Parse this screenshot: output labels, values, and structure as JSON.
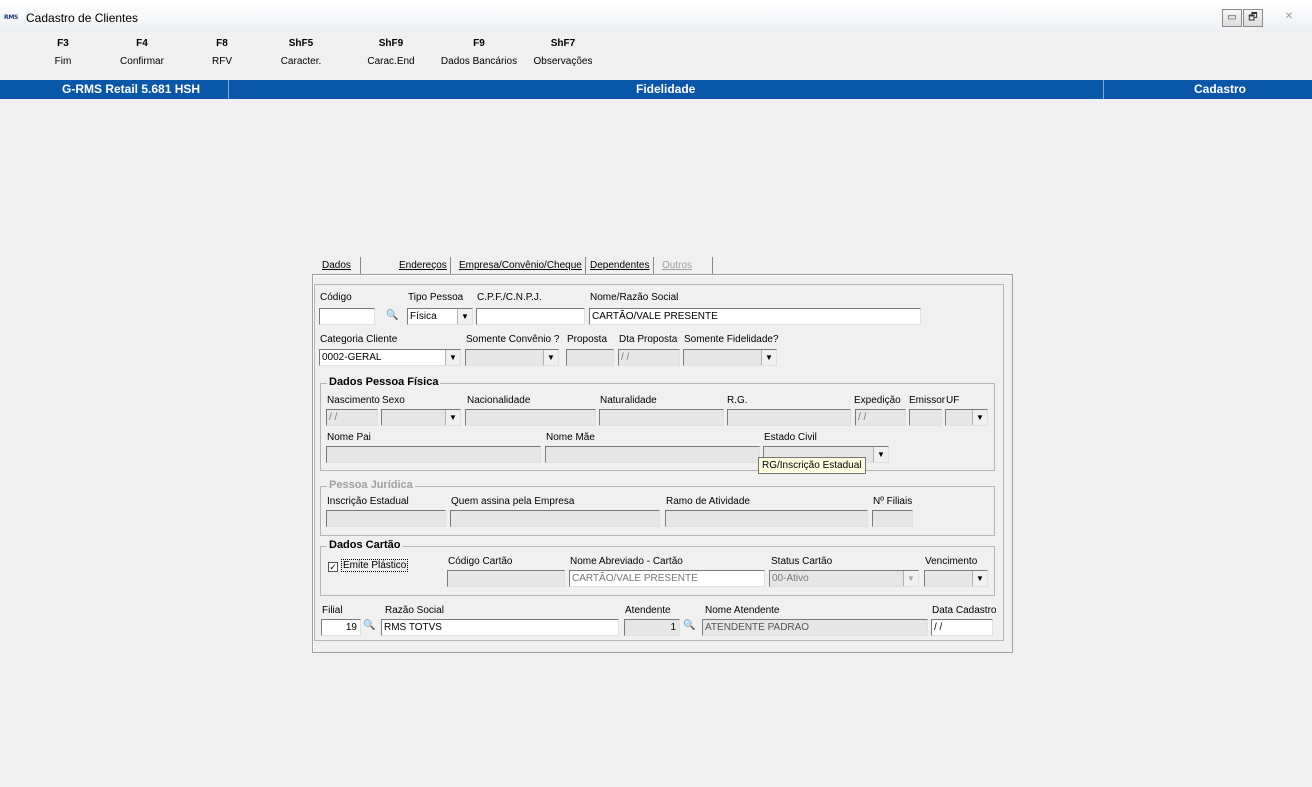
{
  "window": {
    "app_icon": "RMS",
    "title": "Cadastro de Clientes",
    "controls": [
      "▭",
      "🗗",
      "✕"
    ]
  },
  "function_keys": [
    {
      "key": "F3",
      "label": "Fim"
    },
    {
      "key": "F4",
      "label": "Confirmar"
    },
    {
      "key": "F8",
      "label": "RFV"
    },
    {
      "key": "ShF5",
      "label": "Caracter."
    },
    {
      "key": "ShF9",
      "label": "Carac.End"
    },
    {
      "key": "F9",
      "label": "Dados Bancários"
    },
    {
      "key": "ShF7",
      "label": "Observações"
    }
  ],
  "status_bar": {
    "left": "G-RMS Retail 5.681 HSH",
    "center": "Fidelidade",
    "right": "Cadastro"
  },
  "tabs": [
    {
      "label": "Dados Básicos",
      "state": "active"
    },
    {
      "label": "Endereços",
      "state": "normal"
    },
    {
      "label": "Empresa/Convênio/Cheque",
      "state": "normal"
    },
    {
      "label": "Dependentes",
      "state": "normal"
    },
    {
      "label": "Outros Convênios",
      "state": "disabled"
    }
  ],
  "basic": {
    "codigo_label": "Código",
    "codigo_value": "",
    "tipo_pessoa_label": "Tipo Pessoa",
    "tipo_pessoa_value": "Física",
    "cpf_label": "C.P.F./C.N.P.J.",
    "cpf_value": "",
    "nome_label": "Nome/Razão Social",
    "nome_value": "CARTÃO/VALE PRESENTE",
    "categoria_label": "Categoria Cliente",
    "categoria_value": "0002-GERAL",
    "somente_convenio_label": "Somente Convênio ?",
    "proposta_label": "Proposta",
    "dta_proposta_label": "Dta Proposta",
    "dta_proposta_value": "/ /",
    "somente_fidelidade_label": "Somente Fidelidade?"
  },
  "pessoa_fisica": {
    "title": "Dados Pessoa Física",
    "nascimento_label": "Nascimento",
    "nascimento_value": "/ /",
    "sexo_label": "Sexo",
    "nacionalidade_label": "Nacionalidade",
    "naturalidade_label": "Naturalidade",
    "rg_label": "R.G.",
    "expedicao_label": "Expedição",
    "expedicao_value": "/ /",
    "emissor_label": "Emissor",
    "uf_label": "UF",
    "nome_pai_label": "Nome Pai",
    "nome_mae_label": "Nome Mãe",
    "estado_civil_label": "Estado Civil",
    "tooltip": "RG/Inscrição Estadual"
  },
  "pessoa_juridica": {
    "title": "Pessoa Jurídica",
    "inscricao_label": "Inscrição Estadual",
    "quem_assina_label": "Quem assina pela Empresa",
    "ramo_label": "Ramo de Atividade",
    "filiais_label": "Nº Filiais"
  },
  "cartao": {
    "title": "Dados Cartão",
    "emite_label": "Emite Plástico",
    "emite_checked": "✓",
    "codigo_label": "Código Cartão",
    "nome_abrev_label": "Nome Abreviado - Cartão",
    "nome_abrev_value": "CARTÃO/VALE PRESENTE",
    "status_label": "Status Cartão",
    "status_value": "00-Ativo",
    "vencimento_label": "Vencimento"
  },
  "footer": {
    "filial_label": "Filial",
    "filial_value": "19",
    "razao_label": "Razão Social",
    "razao_value": "RMS TOTVS",
    "atendente_label": "Atendente",
    "atendente_value": "1",
    "nome_atendente_label": "Nome Atendente",
    "nome_atendente_value": "ATENDENTE PADRAO",
    "data_cadastro_label": "Data Cadastro",
    "data_cadastro_value": "/ /"
  },
  "colors": {
    "status_bar": "#0a56a8",
    "window_bg": "#f0f0f0",
    "tooltip_bg": "#ffffe1"
  }
}
